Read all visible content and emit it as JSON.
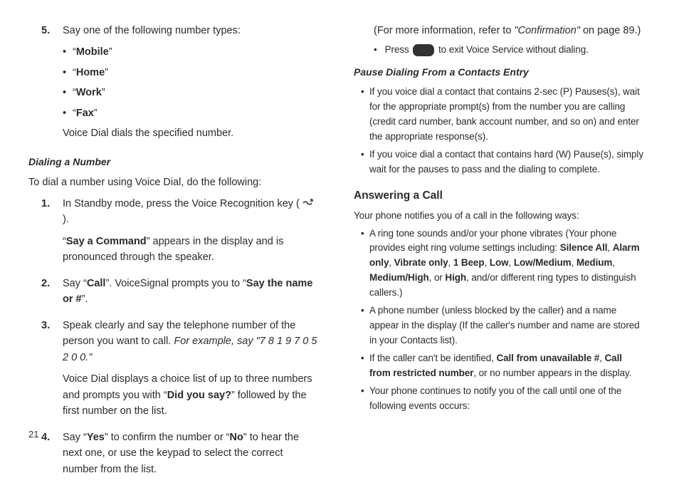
{
  "left": {
    "item5": {
      "num": "5.",
      "intro": "Say one of the following number types:",
      "types": [
        "Mobile",
        "Home",
        "Work",
        "Fax"
      ],
      "outro": "Voice Dial dials the specified number."
    },
    "dialing_heading": "Dialing a Number",
    "dialing_intro": "To dial a number using Voice Dial, do the following:",
    "step1": {
      "num": "1.",
      "line1_a": "In Standby mode, press the Voice Recognition key (",
      "line1_b": ").",
      "line2_a": "“",
      "line2_bold": "Say a Command",
      "line2_b": "” appears in the display and is pronounced through the speaker."
    },
    "step2": {
      "num": "2.",
      "a": "Say “",
      "bold1": "Call",
      "b": "”. VoiceSignal prompts you to “",
      "bold2": "Say the name or #",
      "c": "”."
    },
    "step3": {
      "num": "3.",
      "line1": "Speak clearly and say the telephone number of the person you want to call. ",
      "example": "For example, say \"7 8 1 9 7 0 5 2 0 0.\"",
      "line2_a": "Voice Dial displays a choice list of up to three numbers and prompts you with “",
      "line2_bold": "Did you say?",
      "line2_b": "” followed by the first number on the list."
    },
    "step4": {
      "num": "4.",
      "a": "Say “",
      "yes": "Yes",
      "b": "” to confirm the number or “",
      "no": "No",
      "c": "” to hear the next one, or use the keypad to select the correct number from the list."
    }
  },
  "right": {
    "more_info_a": "(For more information, refer to ",
    "more_info_ital": "\"Confirmation\"",
    "more_info_b": " on page 89.)",
    "press_a": "Press",
    "press_b": "to exit Voice Service without dialing.",
    "pause_heading": "Pause Dialing From a Contacts Entry",
    "pause_b1": "If you voice dial a contact that contains 2-sec (P) Pauses(s), wait for the appropriate prompt(s) from the number you are calling (credit card number, bank account number, and so on) and enter the appropriate response(s).",
    "pause_b2": "If you voice dial a contact that contains hard (W) Pause(s), simply wait for the pauses to pass and the dialing to complete.",
    "answer_heading": "Answering a Call",
    "answer_intro": "Your phone notifies you of a call in the following ways:",
    "ans1_a": "A ring tone sounds and/or your phone vibrates (Your phone provides eight ring volume settings including: ",
    "ans1_list": [
      "Silence All",
      "Alarm only",
      "Vibrate only",
      "1 Beep",
      "Low",
      "Low/Medium",
      "Medium",
      "Medium/High"
    ],
    "ans1_mid": ", or ",
    "ans1_last": "High",
    "ans1_b": ", and/or different ring types to distinguish callers.)",
    "ans2": "A phone number (unless blocked by the caller) and a name appear in the display (If the caller's number and name are stored in your Contacts list).",
    "ans3_a": "If the caller can't be identified, ",
    "ans3_b1": "Call from unavailable #",
    "ans3_b": ", ",
    "ans3_b2": "Call from restricted number",
    "ans3_c": ", or no number appears in the display.",
    "ans4": "Your phone continues to notify you of the call until one of the following events occurs:"
  },
  "page_number": "21"
}
